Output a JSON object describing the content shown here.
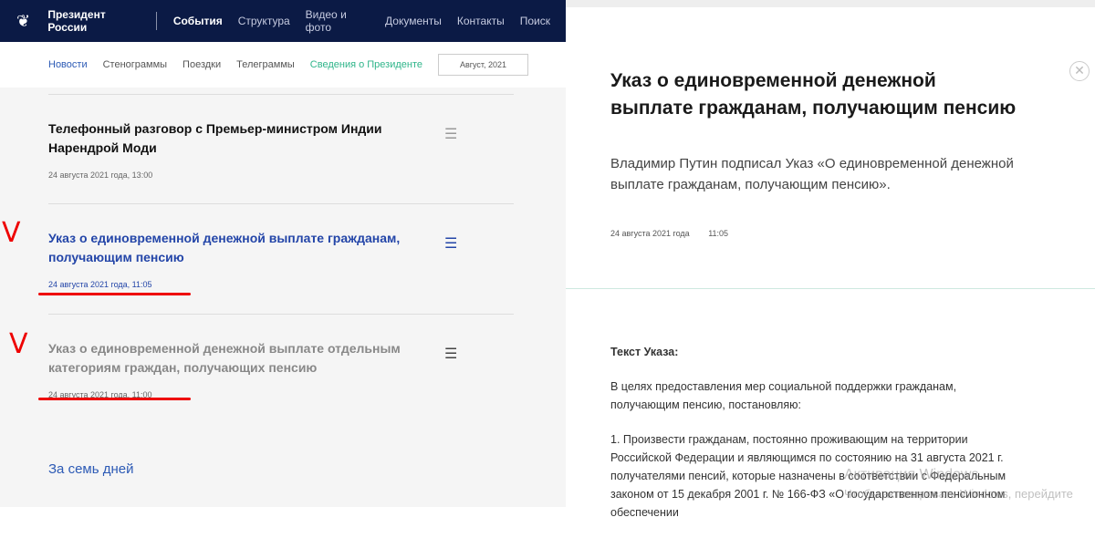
{
  "header": {
    "brand": "Президент России",
    "nav": [
      "События",
      "Структура",
      "Видео и фото",
      "Документы",
      "Контакты",
      "Поиск"
    ]
  },
  "subnav": {
    "items": [
      "Новости",
      "Стенограммы",
      "Поездки",
      "Телеграммы"
    ],
    "info": "Сведения о Президенте",
    "date": "Август, 2021"
  },
  "items": [
    {
      "title": "Телефонный разговор с Премьер-министром Индии Нарендрой Моди",
      "date": "24 августа 2021 года, 13:00"
    },
    {
      "title": "Указ о единовременной денежной выплате гражданам, получающим пенсию",
      "date": "24 августа 2021 года, 11:05"
    },
    {
      "title": "Указ о единовременной денежной выплате отдельным категориям граждан, получающих пенсию",
      "date": "24 августа 2021 года, 11:00"
    }
  ],
  "annotation_mark": "V",
  "week_link": "За семь дней",
  "article": {
    "title": "Указ о единовременной денежной выплате гражданам, получающим пенсию",
    "lead": "Владимир Путин подписал Указ «О единовременной денежной выплате гражданам, получающим пенсию».",
    "date": "24 августа 2021 года",
    "time": "11:05",
    "text_heading": "Текст Указа:",
    "p1": "В целях предоставления мер социальной поддержки гражданам, получающим пенсию, постановляю:",
    "p2": "1. Произвести гражданам, постоянно проживающим на территории Российской Федерации и являющимся по состоянию на 31 августа 2021 г. получателями пенсий, которые назначены в соответствии с Федеральным законом от 15 декабря 2001 г. № 166-ФЗ «О государственном пенсионном обеспечении"
  },
  "watermark": {
    "line1": "Активация Windows",
    "line2": "Чтобы активировать Windows, перейдите"
  }
}
